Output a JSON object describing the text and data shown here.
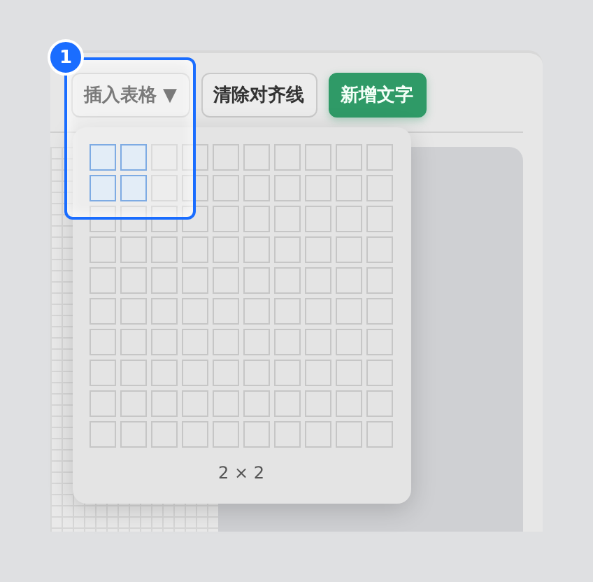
{
  "toolbar": {
    "buttons": [
      {
        "label": "插入表格 ▼",
        "kind": "dropdown"
      },
      {
        "label": "清除对齐线",
        "kind": "plain"
      },
      {
        "label": "新增文字",
        "kind": "primary"
      }
    ]
  },
  "table_picker": {
    "rows": [
      {
        "cells": [
          {
            "selected": true
          },
          {
            "selected": true
          },
          {
            "selected": false
          },
          {
            "selected": false
          },
          {
            "selected": false
          },
          {
            "selected": false
          },
          {
            "selected": false
          },
          {
            "selected": false
          },
          {
            "selected": false
          },
          {
            "selected": false
          }
        ]
      },
      {
        "cells": [
          {
            "selected": true
          },
          {
            "selected": true
          },
          {
            "selected": false
          },
          {
            "selected": false
          },
          {
            "selected": false
          },
          {
            "selected": false
          },
          {
            "selected": false
          },
          {
            "selected": false
          },
          {
            "selected": false
          },
          {
            "selected": false
          }
        ]
      },
      {
        "cells": [
          {
            "selected": false
          },
          {
            "selected": false
          },
          {
            "selected": false
          },
          {
            "selected": false
          },
          {
            "selected": false
          },
          {
            "selected": false
          },
          {
            "selected": false
          },
          {
            "selected": false
          },
          {
            "selected": false
          },
          {
            "selected": false
          }
        ]
      },
      {
        "cells": [
          {
            "selected": false
          },
          {
            "selected": false
          },
          {
            "selected": false
          },
          {
            "selected": false
          },
          {
            "selected": false
          },
          {
            "selected": false
          },
          {
            "selected": false
          },
          {
            "selected": false
          },
          {
            "selected": false
          },
          {
            "selected": false
          }
        ]
      },
      {
        "cells": [
          {
            "selected": false
          },
          {
            "selected": false
          },
          {
            "selected": false
          },
          {
            "selected": false
          },
          {
            "selected": false
          },
          {
            "selected": false
          },
          {
            "selected": false
          },
          {
            "selected": false
          },
          {
            "selected": false
          },
          {
            "selected": false
          }
        ]
      },
      {
        "cells": [
          {
            "selected": false
          },
          {
            "selected": false
          },
          {
            "selected": false
          },
          {
            "selected": false
          },
          {
            "selected": false
          },
          {
            "selected": false
          },
          {
            "selected": false
          },
          {
            "selected": false
          },
          {
            "selected": false
          },
          {
            "selected": false
          }
        ]
      },
      {
        "cells": [
          {
            "selected": false
          },
          {
            "selected": false
          },
          {
            "selected": false
          },
          {
            "selected": false
          },
          {
            "selected": false
          },
          {
            "selected": false
          },
          {
            "selected": false
          },
          {
            "selected": false
          },
          {
            "selected": false
          },
          {
            "selected": false
          }
        ]
      },
      {
        "cells": [
          {
            "selected": false
          },
          {
            "selected": false
          },
          {
            "selected": false
          },
          {
            "selected": false
          },
          {
            "selected": false
          },
          {
            "selected": false
          },
          {
            "selected": false
          },
          {
            "selected": false
          },
          {
            "selected": false
          },
          {
            "selected": false
          }
        ]
      },
      {
        "cells": [
          {
            "selected": false
          },
          {
            "selected": false
          },
          {
            "selected": false
          },
          {
            "selected": false
          },
          {
            "selected": false
          },
          {
            "selected": false
          },
          {
            "selected": false
          },
          {
            "selected": false
          },
          {
            "selected": false
          },
          {
            "selected": false
          }
        ]
      },
      {
        "cells": [
          {
            "selected": false
          },
          {
            "selected": false
          },
          {
            "selected": false
          },
          {
            "selected": false
          },
          {
            "selected": false
          },
          {
            "selected": false
          },
          {
            "selected": false
          },
          {
            "selected": false
          },
          {
            "selected": false
          },
          {
            "selected": false
          }
        ]
      }
    ],
    "size_label": "2 × 2"
  },
  "callout": {
    "label": "1"
  }
}
